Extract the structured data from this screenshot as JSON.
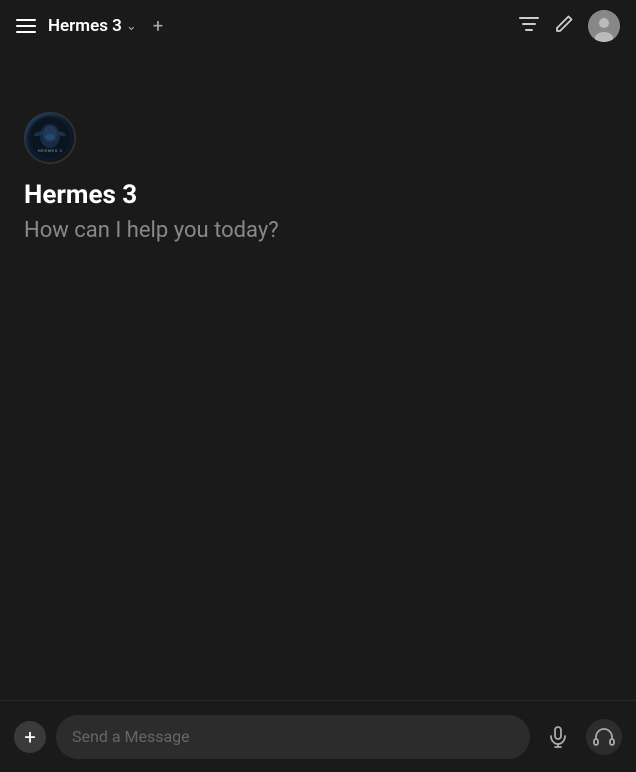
{
  "header": {
    "title": "Hermes 3",
    "chevron": "∨",
    "add_label": "+",
    "hamburger_label": "Menu"
  },
  "icons": {
    "hamburger": "☰",
    "filter": "filter-icon",
    "edit": "edit-icon",
    "add": "+",
    "mic": "mic-icon",
    "headphone": "headphone-icon",
    "chevron_down": "⌄"
  },
  "main": {
    "bot_name": "Hermes 3",
    "bot_subtitle": "How can I help you today?",
    "bot_avatar_label": "HERMES 3"
  },
  "input": {
    "placeholder": "Send a Message",
    "add_button_label": "+"
  },
  "colors": {
    "background": "#1a1a1a",
    "header_bg": "#1a1a1a",
    "input_bg": "#2c2c2c",
    "text_primary": "#ffffff",
    "text_secondary": "#888888",
    "accent": "#aaaaaa"
  }
}
